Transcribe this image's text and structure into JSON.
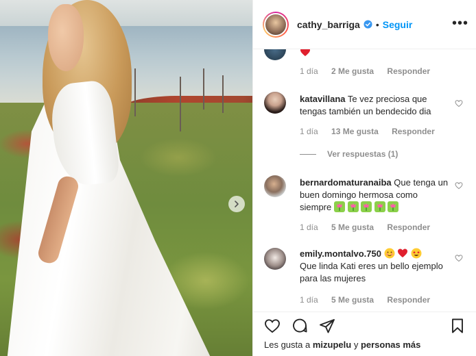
{
  "post": {
    "username": "cathy_barriga",
    "follow_label": "Seguir",
    "separator": "•",
    "more_icon": "more-horizontal-icon"
  },
  "comments": [
    {
      "user": "",
      "text": "",
      "emoji": [
        "red-heart"
      ],
      "time": "1 día",
      "likes": "2 Me gusta",
      "reply_label": "Responder"
    },
    {
      "user": "katavillana",
      "text": "Te vez preciosa que tengas también un bendecido dia",
      "time": "1 día",
      "likes": "13 Me gusta",
      "reply_label": "Responder",
      "view_replies": "Ver respuestas (1)"
    },
    {
      "user": "bernardomaturanaiba",
      "text": "Que tenga un buen domingo hermosa como siempre",
      "emoji": [
        "tulip",
        "tulip",
        "tulip",
        "tulip",
        "tulip"
      ],
      "time": "1 día",
      "likes": "5 Me gusta",
      "reply_label": "Responder"
    },
    {
      "user": "emily.montalvo.750",
      "emoji": [
        "smiling-face",
        "red-heart",
        "star-struck"
      ],
      "text": "Que linda Kati eres un bello ejemplo para las mujeres",
      "time": "1 día",
      "likes": "5 Me gusta",
      "reply_label": "Responder"
    }
  ],
  "likes_line": {
    "prefix": "Les gusta a",
    "user": "mizupelu",
    "joiner": "y",
    "others": "personas más"
  },
  "colors": {
    "link_blue": "#0095f6",
    "text": "#262626",
    "muted": "#8e8e8e",
    "heart_red": "#ed4956"
  }
}
